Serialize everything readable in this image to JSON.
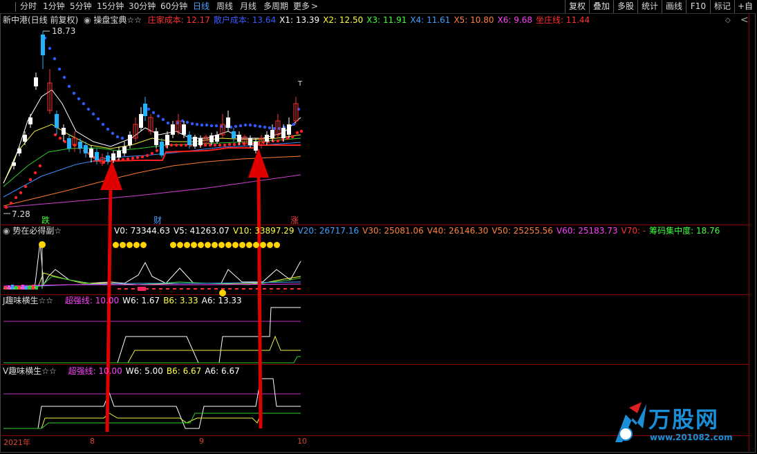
{
  "toolbar": {
    "tabs": [
      "分时",
      "1分钟",
      "5分钟",
      "15分钟",
      "30分钟",
      "60分钟",
      "日线",
      "周线",
      "月线",
      "多周期",
      "更多"
    ],
    "active_tab": "日线",
    "more_arrow": ">",
    "tools": [
      "复权",
      "叠加",
      "多股",
      "统计",
      "画线",
      "F10",
      "标记",
      "+自"
    ]
  },
  "main": {
    "stock_title": "新中港(日线 前复权)",
    "indicator_name": "操盘宝典☆☆",
    "values": [
      {
        "label": "庄家成本: 12.17",
        "color": "#ff3030"
      },
      {
        "label": "散户成本: 13.64",
        "color": "#3b5bff"
      },
      {
        "label": "X1: 13.39",
        "color": "#ffffff"
      },
      {
        "label": "X2: 12.50",
        "color": "#ffff40"
      },
      {
        "label": "X3: 11.91",
        "color": "#40ff40"
      },
      {
        "label": "X4: 11.61",
        "color": "#40a0ff"
      },
      {
        "label": "X5: 10.80",
        "color": "#ff8040"
      },
      {
        "label": "X6: 9.68",
        "color": "#ff40ff"
      },
      {
        "label": "坐庄线: 11.44",
        "color": "#ff3030"
      }
    ],
    "high_label": "18.73",
    "low_label": "7.28",
    "mark_die": "跌",
    "mark_cai": "财",
    "mark_zhang": "涨",
    "mark_t": "T"
  },
  "panel2": {
    "name": "势在必得副☆",
    "values": [
      {
        "label": "V0: 73344.63",
        "color": "#ffffff"
      },
      {
        "label": "V5: 41263.07",
        "color": "#ffffff"
      },
      {
        "label": "V10: 33897.29",
        "color": "#ffff40"
      },
      {
        "label": "V20: 26717.16",
        "color": "#40a0ff"
      },
      {
        "label": "V30: 25081.06",
        "color": "#ff8040"
      },
      {
        "label": "V40: 26146.30",
        "color": "#ff8040"
      },
      {
        "label": "V50: 25255.56",
        "color": "#ff8040"
      },
      {
        "label": "V60: 25183.73",
        "color": "#ff40ff"
      },
      {
        "label": "V70: -",
        "color": "#ff3030"
      },
      {
        "label": "筹码集中度: 18.76",
        "color": "#40ff40"
      }
    ]
  },
  "panel3": {
    "name": "J趣味横生☆☆",
    "values": [
      {
        "label": "超强线: 10.00",
        "color": "#ff40ff"
      },
      {
        "label": "W6: 1.67",
        "color": "#ffffff"
      },
      {
        "label": "B6: 3.33",
        "color": "#ffff40"
      },
      {
        "label": "A6: 13.33",
        "color": "#ffffff"
      }
    ]
  },
  "panel4": {
    "name": "V趣味横生☆☆",
    "values": [
      {
        "label": "超强线: 10.00",
        "color": "#ff40ff"
      },
      {
        "label": "W6: 5.00",
        "color": "#ffffff"
      },
      {
        "label": "B6: 6.67",
        "color": "#ffff40"
      },
      {
        "label": "A6: 6.67",
        "color": "#ffffff"
      }
    ]
  },
  "xaxis": {
    "ticks": [
      "2021年",
      "8",
      "9",
      "10"
    ]
  },
  "logo": {
    "brand": "万股网",
    "url": "www.201082.com"
  },
  "icons": {
    "diamond": "diamond-icon",
    "collapse": "chevron-left-icon"
  }
}
